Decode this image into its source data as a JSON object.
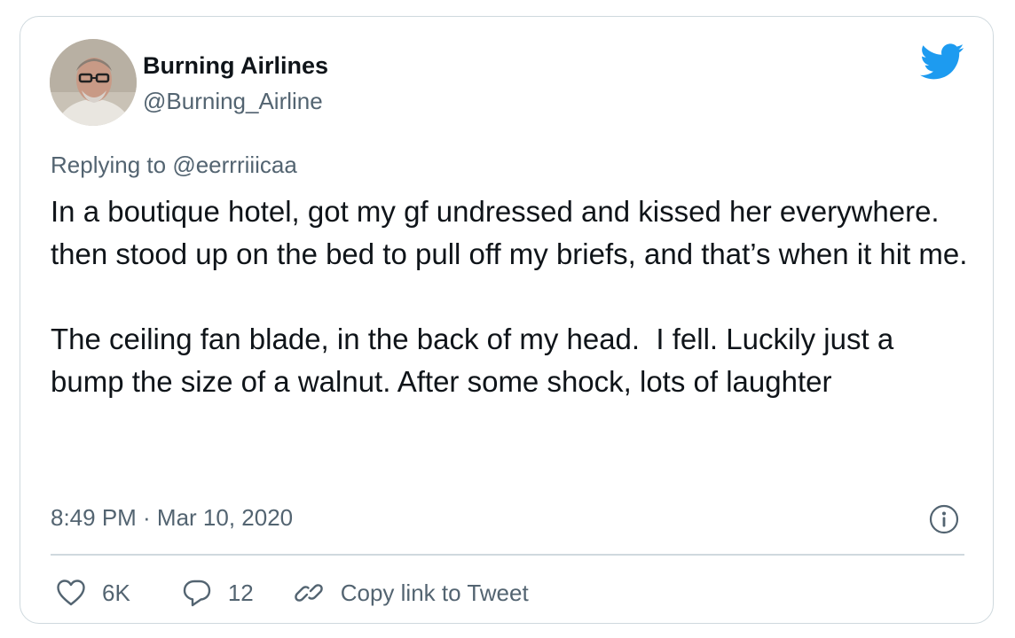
{
  "author": {
    "name": "Burning Airlines",
    "handle": "@Burning_Airline"
  },
  "replying_to": {
    "prefix": "Replying to",
    "mention": "@eerrriiicaa"
  },
  "tweet": {
    "paragraph_1": "In a boutique hotel, got my gf undressed and kissed her everywhere. then stood up on the bed to pull off my briefs, and that’s when it hit me.",
    "paragraph_2": "The ceiling fan blade, in the back of my head.  I fell. Luckily just a bump the size of a walnut. After some shock, lots of laughter",
    "timestamp": "8:49 PM · Mar 10, 2020"
  },
  "actions": {
    "likes": "6K",
    "replies": "12",
    "copy_link": "Copy link to Tweet"
  },
  "icons": {
    "brand": "twitter-bird-icon",
    "info": "info-icon",
    "like": "heart-icon",
    "reply": "speech-bubble-icon",
    "link": "link-icon"
  },
  "colors": {
    "twitter_blue": "#1d9bf0",
    "secondary_text": "#536471",
    "border": "#cfd9de"
  }
}
